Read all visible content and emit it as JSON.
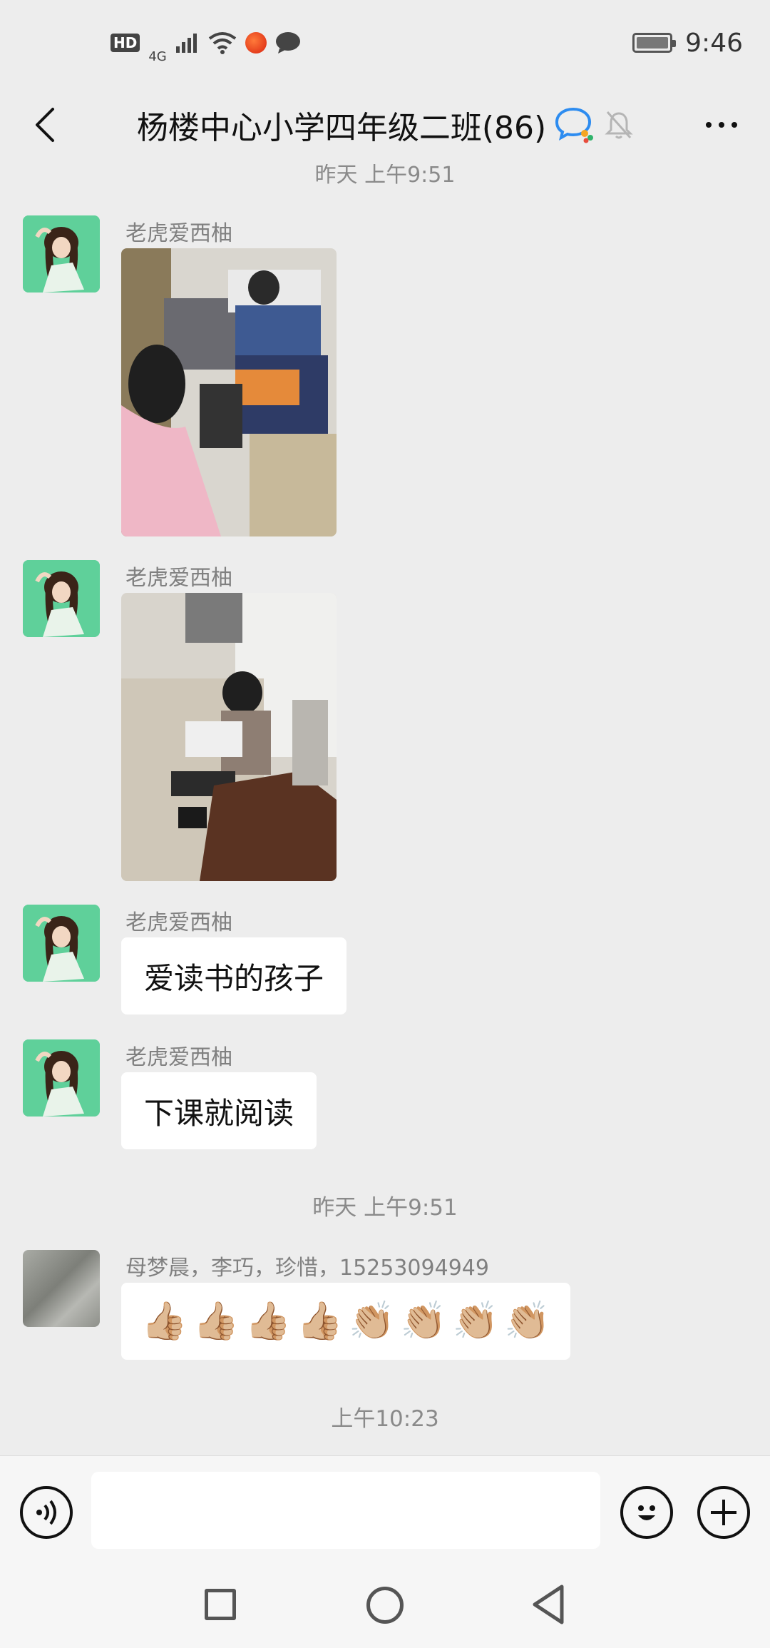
{
  "status_bar": {
    "badge": "HD",
    "network": "4G",
    "time": "9:46"
  },
  "header": {
    "title": "杨楼中心小学四年级二班(86)"
  },
  "messages": [
    {
      "sender": "老虎爱西柚",
      "type": "image"
    },
    {
      "sender": "老虎爱西柚",
      "type": "image"
    },
    {
      "sender": "老虎爱西柚",
      "text": "爱读书的孩子"
    },
    {
      "sender": "老虎爱西柚",
      "text": "下课就阅读"
    },
    {
      "sender": "母梦晨，李巧，珍惜，15253094949",
      "text": "👍🏼👍🏼👍🏼👍🏼👏🏼👏🏼👏🏼👏🏼"
    }
  ],
  "timestamps": {
    "partial_top": "昨天 上午9:51",
    "middle": "昨天 上午9:51",
    "bottom": "上午10:23"
  },
  "emoji_row": [
    "👍🏼",
    "👍🏼",
    "👍🏼",
    "👍🏼",
    "👏🏼",
    "👏🏼",
    "👏🏼",
    "👏🏼"
  ],
  "input": {
    "value": "",
    "placeholder": ""
  },
  "colors": {
    "background": "#ededed",
    "bubble": "#ffffff",
    "avatar_green": "#5fd09a"
  },
  "icons": [
    "back-arrow-icon",
    "wecom-chat-icon",
    "mute-bell-icon",
    "more-icon",
    "voice-icon",
    "emoji-icon",
    "plus-icon",
    "recent-apps-icon",
    "home-icon",
    "back-icon"
  ]
}
